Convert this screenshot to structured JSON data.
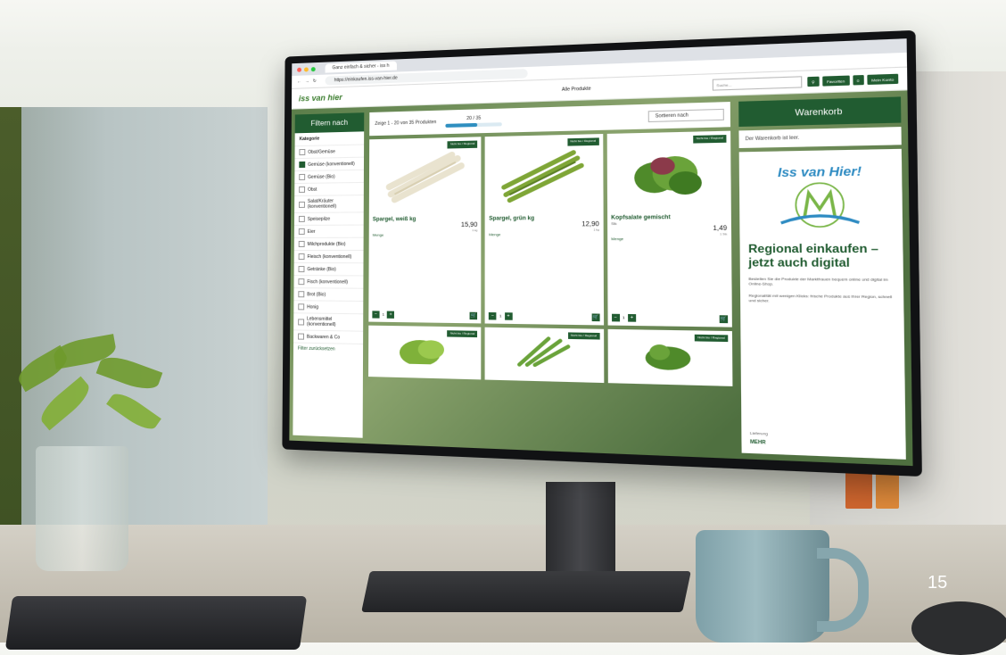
{
  "page_number": "15",
  "browser": {
    "tab_title": "Ganz einfach & sicher - iss h",
    "url": "https://einkaufen.iss-van-hier.de"
  },
  "site": {
    "logo": "iss van hier",
    "header_link": "Alle Produkte",
    "search_placeholder": "Suche...",
    "btn_favorites": "Favoriten",
    "btn_cart": "0",
    "btn_login": "Mein Konto"
  },
  "filter": {
    "title": "Filtern nach",
    "category_label": "Kategorie",
    "items": [
      {
        "label": "Obst/Gemüse",
        "checked": false
      },
      {
        "label": "Gemüse (konventionell)",
        "checked": true
      },
      {
        "label": "Gemüse (Bio)",
        "checked": false
      },
      {
        "label": "Obst",
        "checked": false
      },
      {
        "label": "Salat/Kräuter (konventionell)",
        "checked": false
      },
      {
        "label": "Speisepilze",
        "checked": false
      },
      {
        "label": "Eier",
        "checked": false
      },
      {
        "label": "Milchprodukte (Bio)",
        "checked": false
      },
      {
        "label": "Fleisch (konventionell)",
        "checked": false
      },
      {
        "label": "Getränke (Bio)",
        "checked": false
      },
      {
        "label": "Fisch (konventionell)",
        "checked": false
      },
      {
        "label": "Brot (Bio)",
        "checked": false
      },
      {
        "label": "Honig",
        "checked": false
      },
      {
        "label": "Lebensmittel (konventionell)",
        "checked": false
      },
      {
        "label": "Backwaren & Co",
        "checked": false
      }
    ],
    "more": "Filter zurücksetzen"
  },
  "sortbar": {
    "shown": "Zeige 1 - 20 von 35 Produkten",
    "progress_text": "20 / 35",
    "progress_fraction": 0.57,
    "sort_label": "Sortieren nach"
  },
  "products": [
    {
      "name": "Spargel, weiß kg",
      "sub": "",
      "price": "15,90",
      "base": "1 kg",
      "badge": "Nicht bio / Regional",
      "qty_label": "Menge",
      "qty": "1"
    },
    {
      "name": "Spargel, grün kg",
      "sub": "",
      "price": "12,90",
      "base": "1 kg",
      "badge": "Nicht bio / Regional",
      "qty_label": "Menge",
      "qty": "1"
    },
    {
      "name": "Kopfsalate gemischt",
      "sub": "Stk",
      "price": "1,49",
      "base": "1 Stk",
      "badge": "Nicht bio / Regional",
      "qty_label": "Menge",
      "qty": "1"
    }
  ],
  "more_badges": [
    "Nicht bio / Regional",
    "Nicht bio / Regional",
    "Nicht bio / Regional"
  ],
  "cart": {
    "title": "Warenkorb",
    "empty_text": "Der Warenkorb ist leer.",
    "promo_script": "Iss van Hier!",
    "promo_title": "Regional einkaufen – jetzt auch digital",
    "promo_text1": "Bestellen Sie die Produkte der Marktfrauen bequem online und digital im Online-Shop.",
    "promo_text2": "Regionalität mit wenigen Klicks: frische Produkte aus Ihrer Region, schnell und sicher.",
    "promo_foot": "Lieferung",
    "promo_link": "MEHR"
  },
  "colors": {
    "brand_green": "#215c31",
    "accent_blue": "#2e8bc2"
  }
}
